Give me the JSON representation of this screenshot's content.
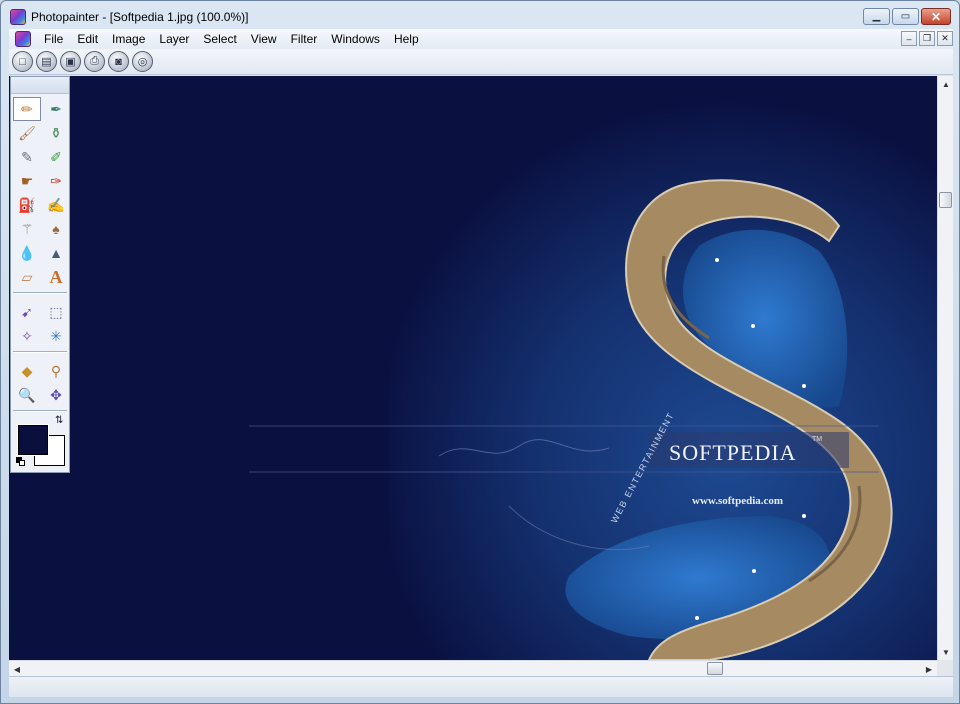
{
  "window": {
    "title": "Photopainter - [Softpedia 1.jpg  (100.0%)]",
    "controls": {
      "minimize": "▁",
      "maximize": "▭",
      "close": "✕"
    }
  },
  "menu": {
    "items": [
      "File",
      "Edit",
      "Image",
      "Layer",
      "Select",
      "View",
      "Filter",
      "Windows",
      "Help"
    ],
    "mdi_controls": {
      "minimize": "–",
      "restore": "❐",
      "close": "✕"
    }
  },
  "toolbar": {
    "buttons": [
      {
        "name": "new-icon",
        "glyph": "□"
      },
      {
        "name": "open-icon",
        "glyph": "▤"
      },
      {
        "name": "save-icon",
        "glyph": "▣"
      },
      {
        "name": "print-icon",
        "glyph": "⎙"
      },
      {
        "name": "scan-icon",
        "glyph": "◙"
      },
      {
        "name": "capture-icon",
        "glyph": "◎"
      }
    ]
  },
  "tools": {
    "group1": [
      {
        "name": "pencil-icon",
        "glyph": "✏",
        "color": "#b8742e"
      },
      {
        "name": "pen-icon",
        "glyph": "✒",
        "color": "#3a7a6a"
      },
      {
        "name": "brush-icon",
        "glyph": "🖌",
        "color": "#a0784a"
      },
      {
        "name": "stamp-icon",
        "glyph": "⚱",
        "color": "#3d8a4f"
      },
      {
        "name": "airbrush-icon",
        "glyph": "✎",
        "color": "#6a6f7a"
      },
      {
        "name": "marker-icon",
        "glyph": "✐",
        "color": "#3c9a3c"
      },
      {
        "name": "smudge-icon",
        "glyph": "☛",
        "color": "#a0602a"
      },
      {
        "name": "red-pen-icon",
        "glyph": "✑",
        "color": "#c03020"
      },
      {
        "name": "paint-bucket-icon",
        "glyph": "⛽",
        "color": "#a06030"
      },
      {
        "name": "eraser-brush-icon",
        "glyph": "✍",
        "color": "#8a4a3a"
      },
      {
        "name": "magic-wand-icon",
        "glyph": "⚚",
        "color": "#7a7f90"
      },
      {
        "name": "fill-brush-icon",
        "glyph": "♠",
        "color": "#9a6a40"
      },
      {
        "name": "blur-drop-icon",
        "glyph": "💧",
        "color": "#3e7cc4"
      },
      {
        "name": "sharpen-icon",
        "glyph": "▲",
        "color": "#4a5a7a"
      },
      {
        "name": "eraser-icon",
        "glyph": "▱",
        "color": "#c08050"
      },
      {
        "name": "text-icon",
        "glyph": "A",
        "color": "#c87030"
      }
    ],
    "group2": [
      {
        "name": "move-selection-icon",
        "glyph": "➹",
        "color": "#6a4aa8"
      },
      {
        "name": "rect-select-icon",
        "glyph": "⬚",
        "color": "#5a5a8a"
      },
      {
        "name": "lasso-icon",
        "glyph": "✧",
        "color": "#7a4aa8"
      },
      {
        "name": "magic-select-icon",
        "glyph": "✳",
        "color": "#3a7ac0"
      }
    ],
    "group3": [
      {
        "name": "transform-icon",
        "glyph": "◆",
        "color": "#c8902a"
      },
      {
        "name": "eyedropper-icon",
        "glyph": "⚲",
        "color": "#b07840"
      },
      {
        "name": "zoom-icon",
        "glyph": "🔍",
        "color": "#3a6ab0"
      },
      {
        "name": "pan-icon",
        "glyph": "✥",
        "color": "#5a4ab0"
      }
    ],
    "colors": {
      "foreground": "#0a0f3e",
      "background": "#ffffff",
      "swap": "⇅"
    }
  },
  "canvas": {
    "watermark_title": "SOFTPEDIA",
    "watermark_tm": "TM",
    "watermark_url": "www.softpedia.com",
    "watermark_curve": "WEB  ENTERTAINMENT",
    "colors": {
      "deep_navy": "#0a1040",
      "ocean": "#1e4a92",
      "lagoon": "#2f7ad0",
      "rock": "#a58a62"
    }
  },
  "scrollbars": {
    "up": "▲",
    "down": "▼",
    "left": "◀",
    "right": "▶"
  }
}
